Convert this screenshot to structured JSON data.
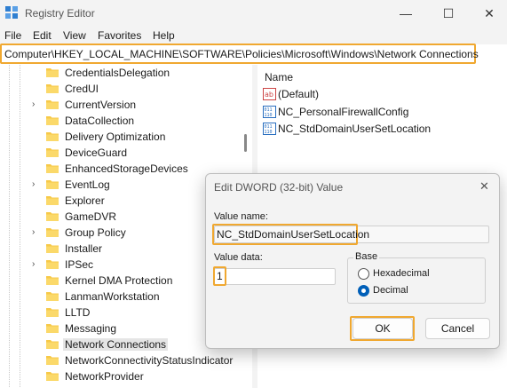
{
  "window": {
    "title": "Registry Editor",
    "minimize_label": "—",
    "maximize_label": "☐",
    "close_label": "✕"
  },
  "menu": [
    "File",
    "Edit",
    "View",
    "Favorites",
    "Help"
  ],
  "address": "Computer\\HKEY_LOCAL_MACHINE\\SOFTWARE\\Policies\\Microsoft\\Windows\\Network Connections",
  "tree": {
    "items": [
      {
        "label": "CredentialsDelegation",
        "expandable": false
      },
      {
        "label": "CredUI",
        "expandable": false
      },
      {
        "label": "CurrentVersion",
        "expandable": true
      },
      {
        "label": "DataCollection",
        "expandable": false
      },
      {
        "label": "Delivery Optimization",
        "expandable": false
      },
      {
        "label": "DeviceGuard",
        "expandable": false
      },
      {
        "label": "EnhancedStorageDevices",
        "expandable": false
      },
      {
        "label": "EventLog",
        "expandable": true
      },
      {
        "label": "Explorer",
        "expandable": false
      },
      {
        "label": "GameDVR",
        "expandable": false
      },
      {
        "label": "Group Policy",
        "expandable": true
      },
      {
        "label": "Installer",
        "expandable": false
      },
      {
        "label": "IPSec",
        "expandable": true
      },
      {
        "label": "Kernel DMA Protection",
        "expandable": false
      },
      {
        "label": "LanmanWorkstation",
        "expandable": false
      },
      {
        "label": "LLTD",
        "expandable": false
      },
      {
        "label": "Messaging",
        "expandable": false
      },
      {
        "label": "Network Connections",
        "expandable": false,
        "selected": true
      },
      {
        "label": "NetworkConnectivityStatusIndicator",
        "expandable": false
      },
      {
        "label": "NetworkProvider",
        "expandable": false
      }
    ]
  },
  "values": {
    "column_name": "Name",
    "items": [
      {
        "label": "(Default)",
        "icon": "string-value-icon"
      },
      {
        "label": "NC_PersonalFirewallConfig",
        "icon": "binary-value-icon"
      },
      {
        "label": "NC_StdDomainUserSetLocation",
        "icon": "binary-value-icon"
      }
    ]
  },
  "dialog": {
    "title": "Edit DWORD (32-bit) Value",
    "close_label": "✕",
    "value_name_label": "Value name:",
    "value_name": "NC_StdDomainUserSetLocation",
    "value_data_label": "Value data:",
    "value_data": "1",
    "base_label": "Base",
    "hex_label": "Hexadecimal",
    "dec_label": "Decimal",
    "base_selected": "Decimal",
    "ok_label": "OK",
    "cancel_label": "Cancel"
  },
  "colors": {
    "highlight": "#f0a830",
    "folder": "#f7c948",
    "accent": "#005fb8"
  }
}
